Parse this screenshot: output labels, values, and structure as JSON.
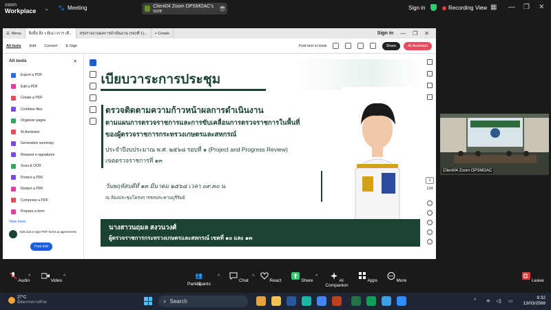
{
  "zoom_top": {
    "logo_line1": "zoom",
    "logo_line2": "Workplace",
    "meeting_label": "Meeting",
    "share_pill": "Client04 Zoom OPSMOAC's scre",
    "sign_in": "Sign in",
    "recording": "Recording",
    "view": "View"
  },
  "acrobat": {
    "tabs": [
      {
        "label": "Menu"
      },
      {
        "label": "สิ่งนี้ล สิ่ง ๆ มีเนาวการ เสื..."
      },
      {
        "label": "สรุปรายงานผลการดำเนินงาน (รอบที่ 1)..."
      },
      {
        "label": "+ Create"
      }
    ],
    "sign_in": "Sign in",
    "toolbar": [
      "All tools",
      "Edit",
      "Convert",
      "E-Sign"
    ],
    "find_text": "Find text or tools",
    "share_btn": "Share",
    "ai_btn": "AI Assistant",
    "all_tools_title": "All tools",
    "tools": [
      {
        "label": "Export a PDF",
        "color": "#2d6cdf"
      },
      {
        "label": "Edit a PDF",
        "color": "#e040a0"
      },
      {
        "label": "Create a PDF",
        "color": "#e34d5c"
      },
      {
        "label": "Combine files",
        "color": "#7b4ddf"
      },
      {
        "label": "Organize pages",
        "color": "#3aa55d"
      },
      {
        "label": "AI Assistant",
        "color": "#e34d5c"
      },
      {
        "label": "Generative summary",
        "color": "#7b4ddf"
      },
      {
        "label": "Request e-signatures",
        "color": "#7b4ddf"
      },
      {
        "label": "Scan & OCR",
        "color": "#3aa55d"
      },
      {
        "label": "Protect a PDF",
        "color": "#7b4ddf"
      },
      {
        "label": "Redact a PDF",
        "color": "#e040a0"
      },
      {
        "label": "Compress a PDF",
        "color": "#e34d5c"
      },
      {
        "label": "Prepare a form",
        "color": "#e040a0"
      }
    ],
    "view_more": "View more",
    "promo": "Edit and e-sign PDF forms & agreements",
    "free_trial": "Free trial",
    "page_number": "1",
    "page_total": "124"
  },
  "slide": {
    "header": "ระเบียบวาระการประชุม",
    "title1": "ตรวจติดตามความก้าวหน้าผลการดำเนินงาน",
    "title2": "ตามแผนการตรวจราชการและการขับเคลื่อนการตรวจราชการในพื้นที่",
    "title3": "ของผู้ตรวจราชการกระทรวงเกษตรและสหกรณ์",
    "line4": "ประจำปีงบประมาณ พ.ศ. ๒๕๖๘ รอบที่ ๑ (Project and Progress Review)",
    "line5": "เขตตรวจราชการที่ ๑๓",
    "date": "วันพฤหัสบดีที่ ๑๓ มีนาคม ๒๕๖๘ เวลา ๐๙.๓๐ น.",
    "place": "ณ ห้องประชุมโครงการชลประทานบุรีรัมย์",
    "name": "นางสาวนฤมล  สงวนวงศ์",
    "position": "ผู้ตรวจราชการกระทรวงเกษตรและสหกรณ์ เขตที่ ๑๐ และ ๑๓"
  },
  "video": {
    "participant_label": "Client04 Zoom OPSMOAC"
  },
  "zoom_bottom": {
    "audio": "Audio",
    "video": "Video",
    "participants": "Participants",
    "participants_count": "11",
    "chat": "Chat",
    "react": "React",
    "share": "Share",
    "ai_companion": "AI Companion",
    "apps": "Apps",
    "more": "More",
    "leave": "Leave"
  },
  "taskbar": {
    "temp": "27°C",
    "weather_desc": "มีลมแรงบางส่วน",
    "search": "Search",
    "time": "9:32",
    "date": "13/03/2568",
    "lang": "ENG"
  },
  "colors": {
    "slide_green": "#1b4332",
    "accent_blue": "#1a5fd6",
    "ai_red": "#e34d5c",
    "record_red": "#e53935"
  }
}
